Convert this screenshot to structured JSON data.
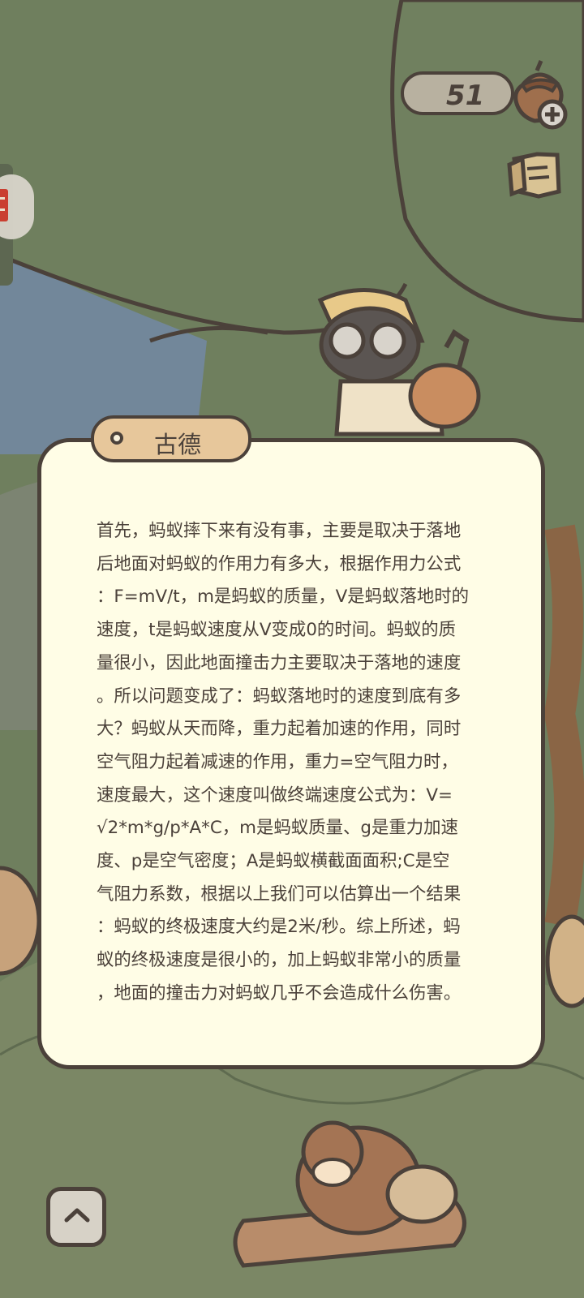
{
  "hud": {
    "acorn_count": "51",
    "acorn_icon": "acorn-icon",
    "thumb_icon": "thumb-up-icon",
    "collapse_icon": "chevron-up-icon"
  },
  "dialogue": {
    "speaker": "古德",
    "text": "首先，蚂蚁摔下来有没有事，主要是取决于落地\n后地面对蚂蚁的作用力有多大，根据作用力公式\n：F=mV/t，m是蚂蚁的质量，V是蚂蚁落地时的\n速度，t是蚂蚁速度从V变成0的时间。蚂蚁的质\n量很小，因此地面撞击力主要取决于落地的速度\n。所以问题变成了：蚂蚁落地时的速度到底有多\n大？蚂蚁从天而降，重力起着加速的作用，同时\n空气阻力起着减速的作用，重力=空气阻力时，\n速度最大，这个速度叫做终端速度公式为：V=\n√2*m*g/p*A*C，m是蚂蚁质量、g是重力加速\n度、p是空气密度；A是蚂蚁横截面面积;C是空\n气阻力系数，根据以上我们可以估算出一个结果\n：蚂蚁的终极速度大约是2米/秒。综上所述，蚂\n蚁的终极速度是很小的，加上蚂蚁非常小的质量\n，地面的撞击力对蚂蚁几乎不会造成什么伤害。"
  },
  "colors": {
    "outline": "#4b413a",
    "dialogue_bg": "#fffde6",
    "name_tag_bg": "#e7c79b",
    "foliage": "#6f7f5e",
    "water": "#72879a"
  }
}
